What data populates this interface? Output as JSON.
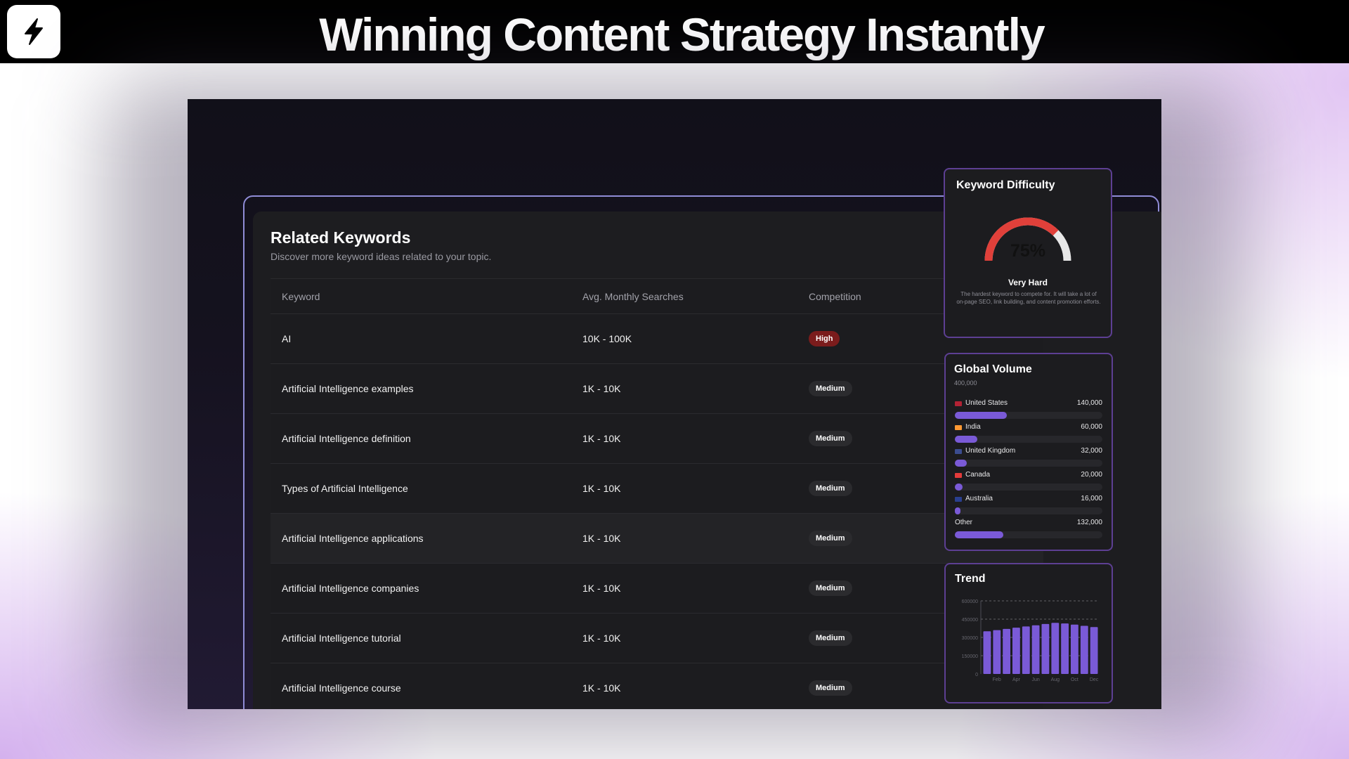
{
  "header": {
    "logo_icon": "lightning-bolt-icon",
    "headline": "Winning Content Strategy Instantly"
  },
  "related": {
    "title": "Related Keywords",
    "subtitle": "Discover more keyword ideas related to your topic.",
    "columns": [
      "Keyword",
      "Avg. Monthly Searches",
      "Competition"
    ],
    "rows": [
      {
        "keyword": "AI",
        "searches": "10K - 100K",
        "competition": "High"
      },
      {
        "keyword": "Artificial Intelligence examples",
        "searches": "1K - 10K",
        "competition": "Medium"
      },
      {
        "keyword": "Artificial Intelligence definition",
        "searches": "1K - 10K",
        "competition": "Medium"
      },
      {
        "keyword": "Types of Artificial Intelligence",
        "searches": "1K - 10K",
        "competition": "Medium"
      },
      {
        "keyword": "Artificial Intelligence applications",
        "searches": "1K - 10K",
        "competition": "Medium"
      },
      {
        "keyword": "Artificial Intelligence companies",
        "searches": "1K - 10K",
        "competition": "Medium"
      },
      {
        "keyword": "Artificial Intelligence tutorial",
        "searches": "1K - 10K",
        "competition": "Medium"
      },
      {
        "keyword": "Artificial Intelligence course",
        "searches": "1K - 10K",
        "competition": "Medium"
      }
    ]
  },
  "difficulty": {
    "title": "Keyword Difficulty",
    "percent_text": "75%",
    "value_percent": 75,
    "label": "Very Hard",
    "description": "The hardest keyword to compete for. It will take a lot of on-page SEO, link building, and content promotion efforts.",
    "gauge_color": "#e0403a",
    "track_color": "#e8e8e8"
  },
  "global_volume": {
    "title": "Global Volume",
    "total": "400,000",
    "max_value": 140000,
    "bar_color": "#7a5ad7",
    "countries": [
      {
        "name": "United States",
        "value_text": "140,000",
        "value": 140000,
        "flag_color": "#b22234"
      },
      {
        "name": "India",
        "value_text": "60,000",
        "value": 60000,
        "flag_color": "#ff9933"
      },
      {
        "name": "United Kingdom",
        "value_text": "32,000",
        "value": 32000,
        "flag_color": "#3b4c8f"
      },
      {
        "name": "Canada",
        "value_text": "20,000",
        "value": 20000,
        "flag_color": "#e33b3b"
      },
      {
        "name": "Australia",
        "value_text": "16,000",
        "value": 16000,
        "flag_color": "#2a3f8f"
      },
      {
        "name": "Other",
        "value_text": "132,000",
        "value": 132000,
        "flag_color": ""
      }
    ]
  },
  "trend": {
    "title": "Trend",
    "chart_data": {
      "type": "bar",
      "ylim": [
        0,
        600000
      ],
      "yticks": [
        "0",
        "150000",
        "300000",
        "450000",
        "600000"
      ],
      "categories": [
        "Jan",
        "Feb",
        "Mar",
        "Apr",
        "May",
        "Jun",
        "Jul",
        "Aug",
        "Sep",
        "Oct",
        "Nov",
        "Dec"
      ],
      "visible_xticks": [
        "Feb",
        "Apr",
        "Jun",
        "Aug",
        "Oct",
        "Dec"
      ],
      "values": [
        350000,
        360000,
        370000,
        380000,
        390000,
        400000,
        410000,
        420000,
        415000,
        405000,
        395000,
        385000
      ],
      "color": "#7a5ad7",
      "grid": true
    }
  }
}
